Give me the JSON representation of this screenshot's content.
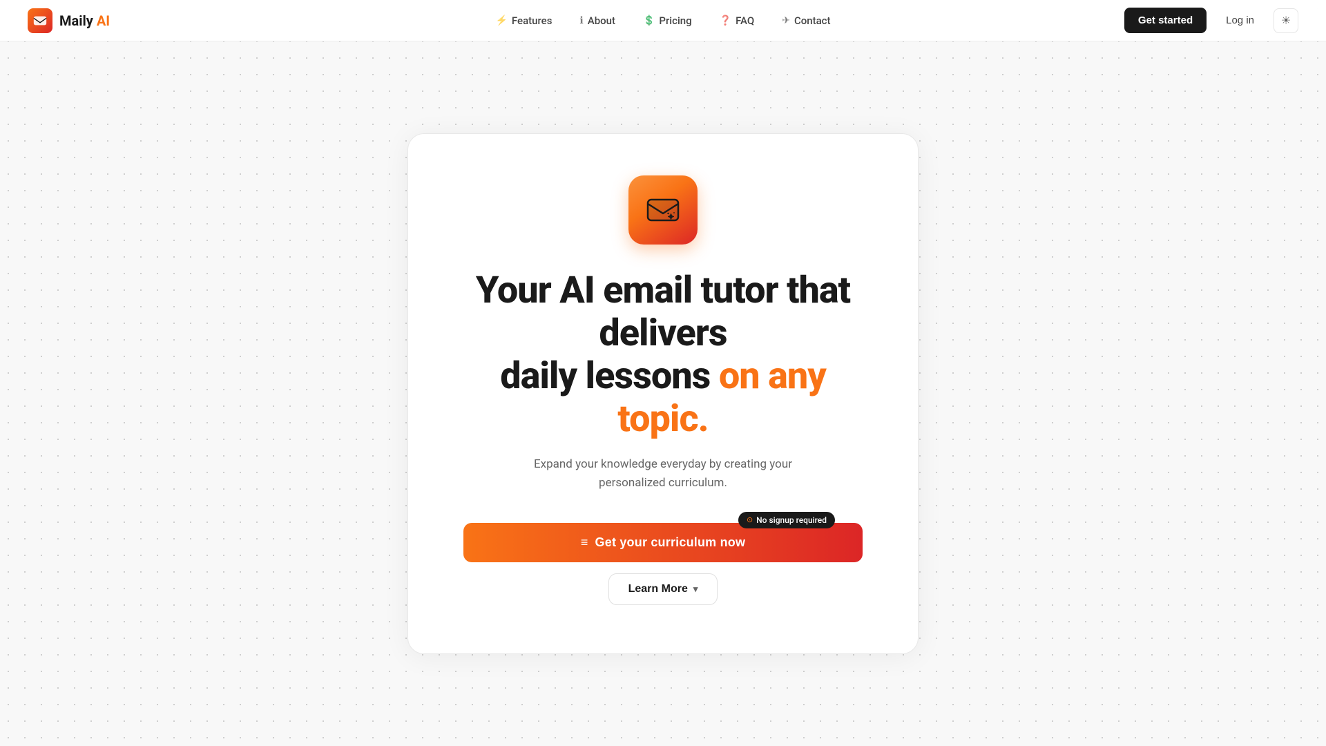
{
  "brand": {
    "name": "Maily",
    "name_highlight": "AI"
  },
  "nav": {
    "links": [
      {
        "id": "features",
        "icon": "⚡",
        "label": "Features"
      },
      {
        "id": "about",
        "icon": "ℹ",
        "label": "About"
      },
      {
        "id": "pricing",
        "icon": "$",
        "label": "Pricing"
      },
      {
        "id": "faq",
        "icon": "?",
        "label": "FAQ"
      },
      {
        "id": "contact",
        "icon": "✈",
        "label": "Contact"
      }
    ],
    "get_started": "Get started",
    "login": "Log in"
  },
  "hero": {
    "title_part1": "Your AI email tutor that delivers",
    "title_part2": "daily lessons ",
    "title_highlight": "on any topic.",
    "subtitle": "Expand your knowledge everyday by creating your personalized curriculum.",
    "cta_label": "Get your curriculum now",
    "no_signup": "No signup required",
    "learn_more": "Learn More"
  }
}
